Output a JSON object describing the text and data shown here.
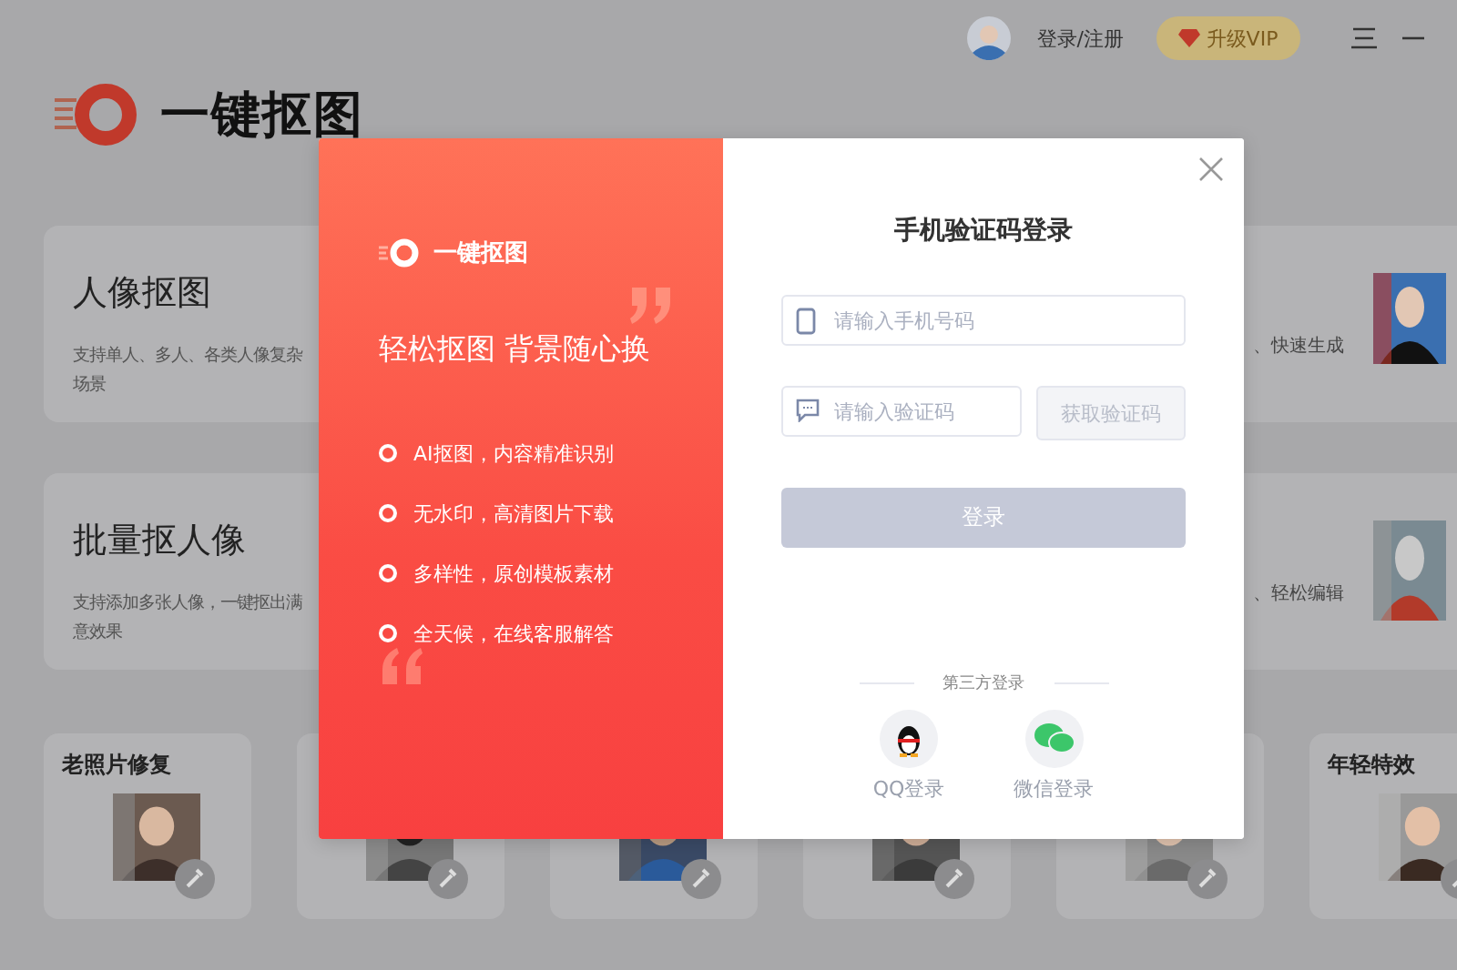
{
  "header": {
    "login_link": "登录/注册",
    "vip_button": "升级VIP"
  },
  "app_logo": "一键抠图",
  "feature_rows": [
    {
      "title": "人像抠图",
      "description": "支持单人、多人、各类人像复杂场景",
      "side_text": "、快速生成"
    },
    {
      "title": "批量抠人像",
      "description": "支持添加多张人像，一键抠出满意效果",
      "side_text": "、轻松编辑"
    }
  ],
  "tool_cards": [
    {
      "kind": "titled",
      "title": "老照片修复"
    },
    {
      "kind": "untitled"
    },
    {
      "kind": "untitled"
    },
    {
      "kind": "untitled"
    },
    {
      "kind": "untitled"
    },
    {
      "kind": "titled",
      "title": "年轻特效"
    }
  ],
  "login_dialog": {
    "promo": {
      "brand": "一键抠图",
      "slogan": "轻松抠图 背景随心换",
      "features": [
        "AI抠图，内容精准识别",
        "无水印，高清图片下载",
        "多样性，原创模板素材",
        "全天候，在线客服解答"
      ]
    },
    "title": "手机验证码登录",
    "phone_field": {
      "placeholder": "请输入手机号码"
    },
    "code_field": {
      "placeholder": "请输入验证码"
    },
    "get_code_button": {
      "label": "获取验证码",
      "disabled": true
    },
    "submit_button": {
      "label": "登录",
      "disabled": true
    },
    "third_party": {
      "heading": "第三方登录",
      "options": [
        {
          "kind": "qq",
          "label": "QQ登录"
        },
        {
          "kind": "wechat",
          "label": "微信登录"
        }
      ]
    }
  }
}
